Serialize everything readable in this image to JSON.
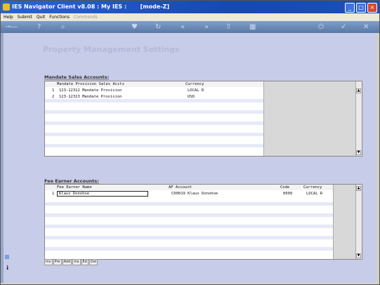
{
  "window": {
    "title": "IES Navigator Client v8.08 : My IES :",
    "mode": "[mode-Z]"
  },
  "menu": [
    "Help",
    "Submit",
    "Quit",
    "Functions",
    "Commands"
  ],
  "page": {
    "title": "Property Management Settings"
  },
  "mandate": {
    "section_title": "Mandate Sales Accounts:",
    "headers": {
      "name": "Mandate Provision Sales Accts",
      "currency": "Currency"
    },
    "rows": [
      {
        "num": "1",
        "name": "123-12312 Mandate Provision",
        "currency": "LOCAL R"
      },
      {
        "num": "2",
        "name": "123-12313 Mandate Provision",
        "currency": "USD"
      }
    ]
  },
  "fee": {
    "section_title": "Fee Earner Accounts:",
    "headers": {
      "name": "Fee Earner Name",
      "ap": "AP Account",
      "code": "Code",
      "currency": "Currency"
    },
    "rows": [
      {
        "num": "1",
        "name": "Klaus Donohoe",
        "ap": "C00019 Klaus Donohoe",
        "code": "0009",
        "currency": "LOCAL R"
      }
    ]
  },
  "grid_buttons": [
    "Inv",
    "Pre",
    "Add",
    "Ins",
    "Ed",
    "Del"
  ],
  "colors": {
    "title_bar": "#1848b0",
    "toolbar": "#5878a8",
    "content_bg": "#c7cce8",
    "page_title": "#b4bad8"
  }
}
